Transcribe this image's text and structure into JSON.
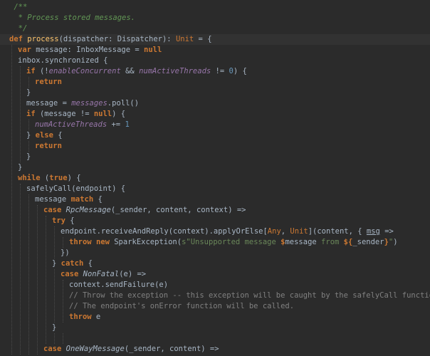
{
  "editor": {
    "theme_colors": {
      "background": "#2b2b2b",
      "keyword": "#cc7832",
      "doc_comment": "#629755",
      "comment": "#808080",
      "field": "#9876aa",
      "number": "#6897bb",
      "string": "#6a8759",
      "function_name": "#ffc66d",
      "plain": "#a9b7c6"
    },
    "lines": [
      {
        "indent": 0,
        "tokens": [
          {
            "t": " /**",
            "k": "doc"
          }
        ]
      },
      {
        "indent": 0,
        "tokens": [
          {
            "t": "  * Process stored messages.",
            "k": "doc"
          }
        ]
      },
      {
        "indent": 0,
        "tokens": [
          {
            "t": "  */",
            "k": "doc"
          }
        ]
      },
      {
        "indent": 0,
        "current": true,
        "tokens": [
          {
            "t": "def",
            "k": "kw"
          },
          {
            "t": " "
          },
          {
            "t": "process",
            "k": "fn"
          },
          {
            "t": "(dispatcher: Dispatcher): "
          },
          {
            "t": "Unit",
            "k": "type"
          },
          {
            "t": " = {"
          }
        ]
      },
      {
        "indent": 1,
        "tokens": [
          {
            "t": "var",
            "k": "kw"
          },
          {
            "t": " message: InboxMessage = "
          },
          {
            "t": "null",
            "k": "kw"
          }
        ]
      },
      {
        "indent": 1,
        "tokens": [
          {
            "t": "inbox.synchronized {"
          }
        ]
      },
      {
        "indent": 2,
        "tokens": [
          {
            "t": "if",
            "k": "kw"
          },
          {
            "t": " (!"
          },
          {
            "t": "enableConcurrent",
            "k": "field"
          },
          {
            "t": " && "
          },
          {
            "t": "numActiveThreads",
            "k": "field"
          },
          {
            "t": " != "
          },
          {
            "t": "0",
            "k": "num"
          },
          {
            "t": ") {"
          }
        ]
      },
      {
        "indent": 3,
        "tokens": [
          {
            "t": "return",
            "k": "kw"
          }
        ]
      },
      {
        "indent": 2,
        "tokens": [
          {
            "t": "}"
          }
        ]
      },
      {
        "indent": 2,
        "tokens": [
          {
            "t": "message = "
          },
          {
            "t": "messages",
            "k": "field"
          },
          {
            "t": ".poll()"
          }
        ]
      },
      {
        "indent": 2,
        "tokens": [
          {
            "t": "if",
            "k": "kw"
          },
          {
            "t": " (message != "
          },
          {
            "t": "null",
            "k": "kw"
          },
          {
            "t": ") {"
          }
        ]
      },
      {
        "indent": 3,
        "tokens": [
          {
            "t": "numActiveThreads",
            "k": "field"
          },
          {
            "t": " += "
          },
          {
            "t": "1",
            "k": "num"
          }
        ]
      },
      {
        "indent": 2,
        "tokens": [
          {
            "t": "} "
          },
          {
            "t": "else",
            "k": "kw"
          },
          {
            "t": " {"
          }
        ]
      },
      {
        "indent": 3,
        "tokens": [
          {
            "t": "return",
            "k": "kw"
          }
        ]
      },
      {
        "indent": 2,
        "tokens": [
          {
            "t": "}"
          }
        ]
      },
      {
        "indent": 1,
        "tokens": [
          {
            "t": "}"
          }
        ]
      },
      {
        "indent": 1,
        "tokens": [
          {
            "t": "while",
            "k": "kw"
          },
          {
            "t": " ("
          },
          {
            "t": "true",
            "k": "kw"
          },
          {
            "t": ") {"
          }
        ]
      },
      {
        "indent": 2,
        "tokens": [
          {
            "t": "safelyCall(endpoint) {"
          }
        ]
      },
      {
        "indent": 3,
        "tokens": [
          {
            "t": "message "
          },
          {
            "t": "match",
            "k": "kw"
          },
          {
            "t": " {"
          }
        ]
      },
      {
        "indent": 4,
        "tokens": [
          {
            "t": "case",
            "k": "kw"
          },
          {
            "t": " "
          },
          {
            "t": "RpcMessage",
            "k": "it"
          },
          {
            "t": "(_sender, content, context) =>"
          }
        ]
      },
      {
        "indent": 5,
        "tokens": [
          {
            "t": "try",
            "k": "kw"
          },
          {
            "t": " {"
          }
        ]
      },
      {
        "indent": 6,
        "tokens": [
          {
            "t": "endpoint.receiveAndReply(context).applyOrElse["
          },
          {
            "t": "Any",
            "k": "type"
          },
          {
            "t": ", "
          },
          {
            "t": "Unit",
            "k": "type"
          },
          {
            "t": "](content, { "
          },
          {
            "t": "msg",
            "k": "un"
          },
          {
            "t": " =>"
          }
        ]
      },
      {
        "indent": 7,
        "tokens": [
          {
            "t": "throw",
            "k": "kw"
          },
          {
            "t": " "
          },
          {
            "t": "new",
            "k": "kw"
          },
          {
            "t": " SparkException("
          },
          {
            "t": "s\"Unsupported message ",
            "k": "str"
          },
          {
            "t": "$",
            "k": "kw"
          },
          {
            "t": "message"
          },
          {
            "t": " from ",
            "k": "str"
          },
          {
            "t": "${",
            "k": "kw"
          },
          {
            "t": "_sender"
          },
          {
            "t": "}",
            "k": "kw"
          },
          {
            "t": "\"",
            "k": "str"
          },
          {
            "t": ")"
          }
        ]
      },
      {
        "indent": 6,
        "tokens": [
          {
            "t": "})"
          }
        ]
      },
      {
        "indent": 5,
        "tokens": [
          {
            "t": "} "
          },
          {
            "t": "catch",
            "k": "kw"
          },
          {
            "t": " {"
          }
        ]
      },
      {
        "indent": 6,
        "tokens": [
          {
            "t": "case",
            "k": "kw"
          },
          {
            "t": " "
          },
          {
            "t": "NonFatal",
            "k": "it"
          },
          {
            "t": "(e) =>"
          }
        ]
      },
      {
        "indent": 7,
        "tokens": [
          {
            "t": "context.sendFailure(e)"
          }
        ]
      },
      {
        "indent": 7,
        "tokens": [
          {
            "t": "// Throw the exception -- this exception will be caught by the safelyCall function.",
            "k": "cmt"
          }
        ]
      },
      {
        "indent": 7,
        "tokens": [
          {
            "t": "// The endpoint's onError function will be called.",
            "k": "cmt"
          }
        ]
      },
      {
        "indent": 7,
        "tokens": [
          {
            "t": "throw",
            "k": "kw"
          },
          {
            "t": " e"
          }
        ]
      },
      {
        "indent": 5,
        "tokens": [
          {
            "t": "}"
          }
        ]
      },
      {
        "indent": 0,
        "tokens": []
      },
      {
        "indent": 4,
        "tokens": [
          {
            "t": "case",
            "k": "kw"
          },
          {
            "t": " "
          },
          {
            "t": "OneWayMessage",
            "k": "it"
          },
          {
            "t": "(_sender, content) =>"
          }
        ]
      }
    ]
  }
}
